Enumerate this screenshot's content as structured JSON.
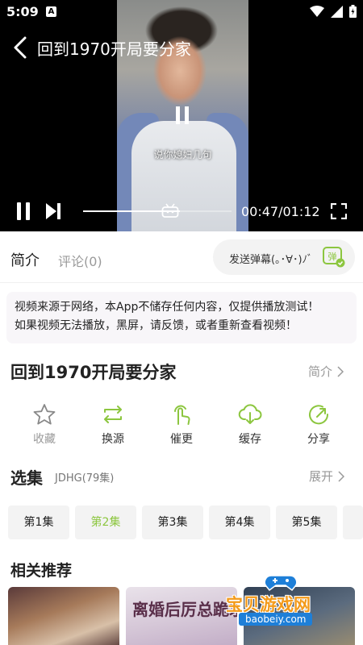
{
  "status_bar": {
    "time": "5:09",
    "notification": "A"
  },
  "video": {
    "title": "回到1970开局要分家",
    "subtitle": "说你媳妇几句",
    "time_display": "00:47/01:12",
    "progress": 0.65
  },
  "tabs": {
    "intro": "简介",
    "comments": "评论(0)"
  },
  "danmu": {
    "placeholder": "发送弹幕(｡･∀･)ﾉﾞ",
    "icon_char": "弹"
  },
  "notice": {
    "line1": "视频来源于网络，本App不储存任何内容，仅提供播放测试！",
    "line2": "如果视频无法播放，黑屏，请反馈，或者重新查看视频！"
  },
  "show": {
    "title": "回到1970开局要分家",
    "intro_link": "简介"
  },
  "actions": [
    {
      "label": "收藏",
      "icon": "star-icon"
    },
    {
      "label": "换源",
      "icon": "switch-source-icon"
    },
    {
      "label": "催更",
      "icon": "urge-update-icon"
    },
    {
      "label": "缓存",
      "icon": "download-cache-icon"
    },
    {
      "label": "分享",
      "icon": "share-icon"
    }
  ],
  "episodes": {
    "heading": "选集",
    "source": "JDHG(79集)",
    "expand": "展开",
    "items": [
      "第1集",
      "第2集",
      "第3集",
      "第4集",
      "第5集"
    ],
    "active_index": 1
  },
  "related": {
    "heading": "相关推荐",
    "poster2_title": "离婚后厉总跪求"
  },
  "watermark": {
    "main": "宝贝游戏网",
    "sub": "baobeiy.com"
  },
  "colors": {
    "accent": "#8cc63f",
    "muted": "#999999",
    "video_bg": "#000000"
  }
}
